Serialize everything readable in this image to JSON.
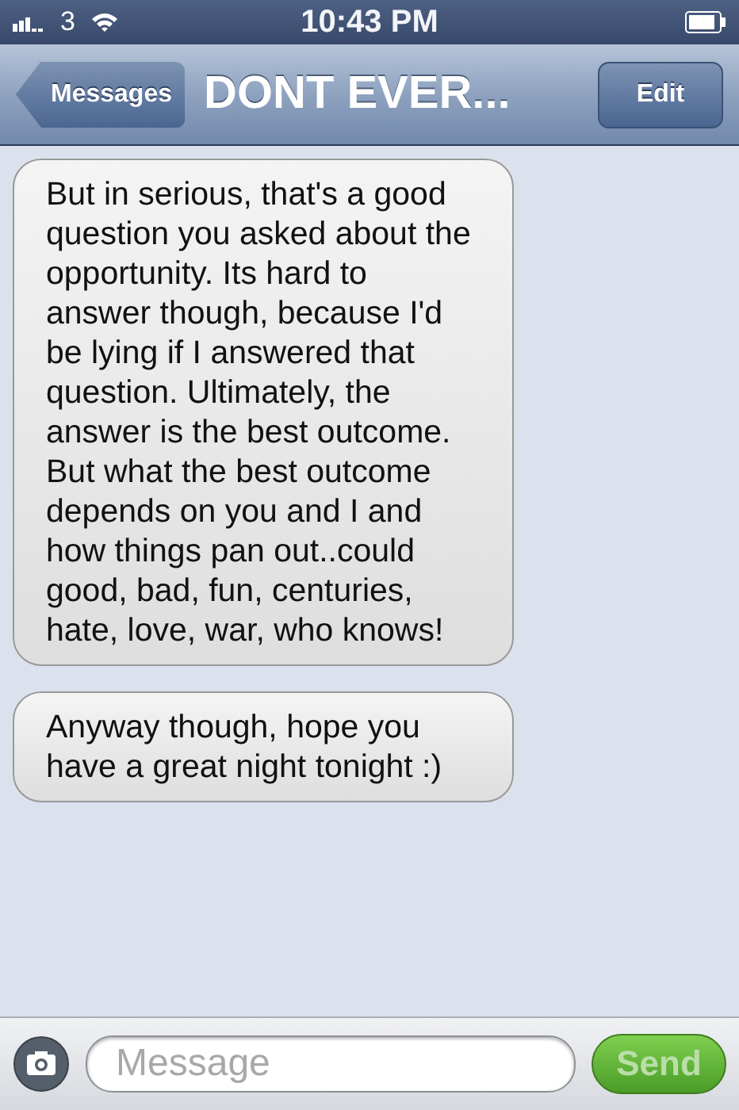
{
  "status_bar": {
    "carrier": "3",
    "time": "10:43 PM"
  },
  "nav": {
    "back": "Messages",
    "title": "DONT EVER...",
    "edit": "Edit"
  },
  "messages": [
    {
      "text": "But in serious, that's a good question you asked about the opportunity. Its hard to answer though, because I'd be lying if I answered that question. Ultimately, the answer is the best outcome. But what the best outcome depends on you and I and how things pan out..could good, bad, fun, centuries, hate, love, war, who knows!",
      "outgoing": false
    },
    {
      "text": "Anyway though, hope you have a great night tonight :)",
      "outgoing": false
    }
  ],
  "composer": {
    "placeholder": "Message",
    "send": "Send",
    "send_disabled": true
  }
}
